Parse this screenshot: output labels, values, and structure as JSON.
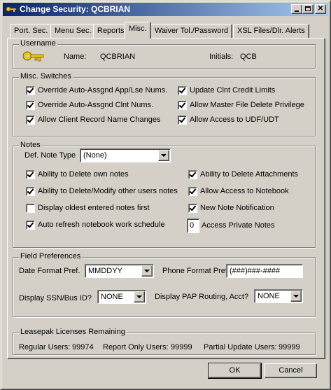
{
  "window": {
    "title": "Change Security: QCBRIAN",
    "icon": "key-icon",
    "controls": [
      "minimize",
      "maximize",
      "close"
    ]
  },
  "tabs": [
    {
      "label": "Port. Sec.",
      "active": false
    },
    {
      "label": "Menu Sec.",
      "active": false
    },
    {
      "label": "Reports",
      "active": false
    },
    {
      "label": "Misc.",
      "active": true
    },
    {
      "label": "Waiver Tol./Password",
      "active": false
    },
    {
      "label": "XSL Files/Dlr. Alerts",
      "active": false
    }
  ],
  "username": {
    "legend": "Username",
    "icon": "keys-icon",
    "name_label": "Name:",
    "name_value": "QCBRIAN",
    "initials_label": "Initials:",
    "initials_value": "QCB"
  },
  "misc_switches": {
    "legend": "Misc. Switches",
    "items": [
      {
        "label": "Override Auto-Assgnd App/Lse Nums.",
        "checked": true
      },
      {
        "label": "Override Auto-Assgnd Clnt Nums.",
        "checked": true
      },
      {
        "label": "Allow Client Record Name Changes",
        "checked": true
      },
      {
        "label": "Update Clnt Credit Limits",
        "checked": true
      },
      {
        "label": "Allow Master File Delete Privilege",
        "checked": true
      },
      {
        "label": "Allow Access to UDF/UDT",
        "checked": true
      }
    ]
  },
  "notes": {
    "legend": "Notes",
    "def_note_type_label": "Def. Note Type",
    "def_note_type_value": "(None)",
    "items": [
      {
        "label": "Ability to Delete own notes",
        "checked": true
      },
      {
        "label": "Ability to Delete/Modify other users notes",
        "checked": true
      },
      {
        "label": "Display oldest entered notes first",
        "checked": false
      },
      {
        "label": "Auto refresh notebook work schedule",
        "checked": true
      },
      {
        "label": "Ability to Delete Attachments",
        "checked": true
      },
      {
        "label": "Allow Access to Notebook",
        "checked": true
      },
      {
        "label": "New Note Notification",
        "checked": true
      }
    ],
    "access_private_value": "0",
    "access_private_label": "Access Private Notes"
  },
  "field_prefs": {
    "legend": "Field Preferences",
    "date_label": "Date Format Pref.",
    "date_value": "MMDDYY",
    "phone_label": "Phone Format Pref.",
    "phone_value": "(###)###-####",
    "ssn_label": "Display SSN/Bus ID?",
    "ssn_value": "NONE",
    "pap_label": "Display PAP Routing, Acct?",
    "pap_value": "NONE"
  },
  "licenses": {
    "legend": "Leasepak Licenses Remaining",
    "regular_label": "Regular Users:",
    "regular_value": "99974",
    "report_label": "Report Only Users:",
    "report_value": "99999",
    "partial_label": "Partial Update Users:",
    "partial_value": "99999"
  },
  "buttons": {
    "ok": "OK",
    "cancel": "Cancel"
  }
}
